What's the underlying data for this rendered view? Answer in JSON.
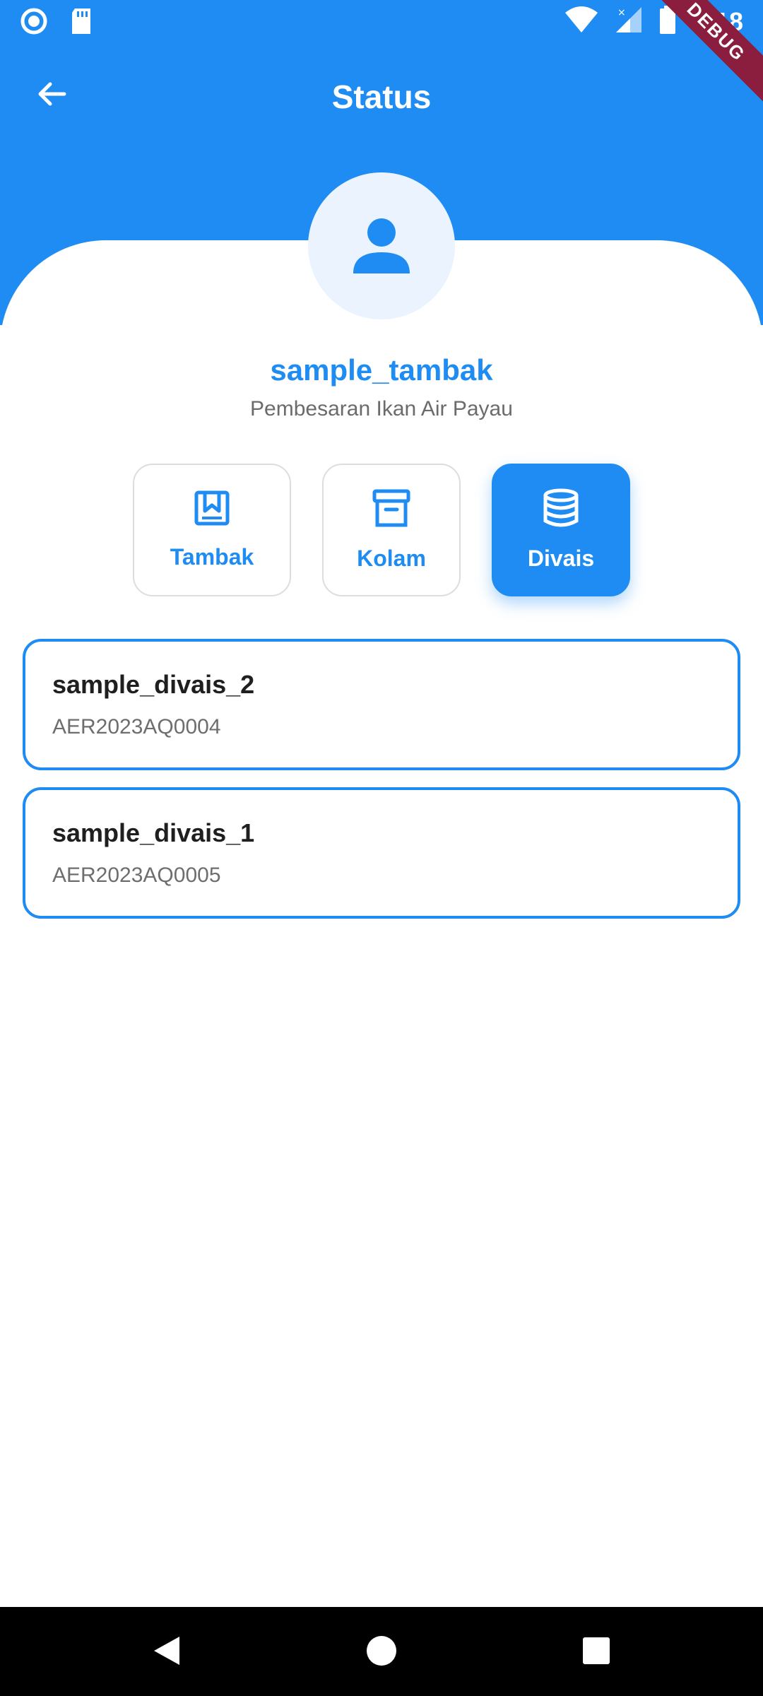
{
  "status_bar": {
    "time": "8:18",
    "icons": [
      "record-icon",
      "sd-card-icon",
      "wifi-icon",
      "signal-icon",
      "battery-icon"
    ]
  },
  "debug_banner": "DEBUG",
  "app_bar": {
    "title": "Status",
    "back_icon": "arrow-left-icon"
  },
  "profile": {
    "avatar_icon": "person-icon",
    "name": "sample_tambak",
    "subtitle": "Pembesaran Ikan Air Payau"
  },
  "tabs": [
    {
      "label": "Tambak",
      "icon": "bookmark-book-icon",
      "active": false
    },
    {
      "label": "Kolam",
      "icon": "archive-box-icon",
      "active": false
    },
    {
      "label": "Divais",
      "icon": "database-icon",
      "active": true
    }
  ],
  "devices": [
    {
      "name": "sample_divais_2",
      "id": "AER2023AQ0004"
    },
    {
      "name": "sample_divais_1",
      "id": "AER2023AQ0005"
    }
  ],
  "colors": {
    "primary": "#1E8CF2",
    "avatar_bg": "#EAF3FE",
    "debug": "#8B1E3F",
    "text_dark": "#1F1F1F",
    "text_muted": "#6E6E6E"
  },
  "nav_bar": {
    "icons": [
      "back-triangle-icon",
      "home-circle-icon",
      "recents-square-icon"
    ]
  }
}
